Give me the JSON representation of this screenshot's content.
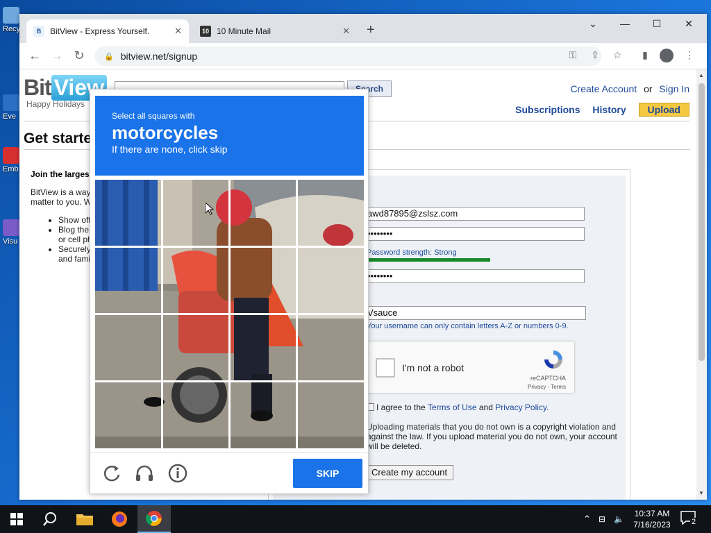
{
  "desktop": {
    "icons": [
      {
        "label": "Recy",
        "color": "#5aa0d8"
      },
      {
        "label": "Eve",
        "color": "#2b6fc4"
      },
      {
        "label": "Emb De",
        "color": "#d83030"
      },
      {
        "label": "Visu",
        "color": "#7a5cc8"
      }
    ]
  },
  "browser": {
    "tabs": [
      {
        "title": "BitView - Express Yourself.",
        "favicon": "BitView",
        "close": "✕"
      },
      {
        "title": "10 Minute Mail",
        "favicon": "10",
        "close": "✕"
      }
    ],
    "new_tab": "+",
    "window_controls": {
      "tab_search": "⌄",
      "minimize": "—",
      "maximize": "☐",
      "close": "✕"
    },
    "url": "bitview.net/signup"
  },
  "site": {
    "logo_bit": "Bit",
    "logo_view": "View",
    "logo_tagline": "Happy Holidays",
    "search_button": "Search",
    "create_account": "Create Account",
    "or": "or",
    "sign_in": "Sign In",
    "nav": [
      "Subscriptions",
      "History"
    ],
    "upload": "Upload",
    "heading": "Get starte",
    "join": "Join the larges",
    "description": [
      "BitView is a way",
      "matter to you. W"
    ],
    "bullets": [
      [
        "Show off"
      ],
      [
        "Blog the",
        "or cell ph"
      ],
      [
        "Securely",
        "and fami"
      ]
    ]
  },
  "form": {
    "email": "awd87895@zslsz.com",
    "password": "••••••••",
    "password_strength": "Password strength: Strong",
    "password_strength_level": 0.7,
    "confirm_password": "••••••••",
    "username": "Vsauce",
    "username_hint": "Your username can only contain letters A-Z or numbers 0-9.",
    "recaptcha_label": "I'm not a robot",
    "recaptcha_brand": "reCAPTCHA",
    "recaptcha_terms": "Privacy - Terms",
    "agree_prefix": "I agree to the",
    "terms_link": "Terms of Use",
    "and": "and",
    "privacy_link": "Privacy Policy.",
    "warning": [
      "Uploading materials that you do not own is a copyright violation and",
      "against the law. If you upload material you do not own, your account",
      "will be deleted."
    ],
    "create_button": "Create my account"
  },
  "challenge": {
    "line1": "Select all squares with",
    "target": "motorcycles",
    "line3": "If there are none, click skip",
    "skip_button": "SKIP",
    "icons": [
      "reload-icon",
      "audio-icon",
      "info-icon"
    ],
    "accent": "#1a73e8"
  },
  "taskbar": {
    "time": "10:37 AM",
    "date": "7/16/2023",
    "notifications": "2"
  }
}
